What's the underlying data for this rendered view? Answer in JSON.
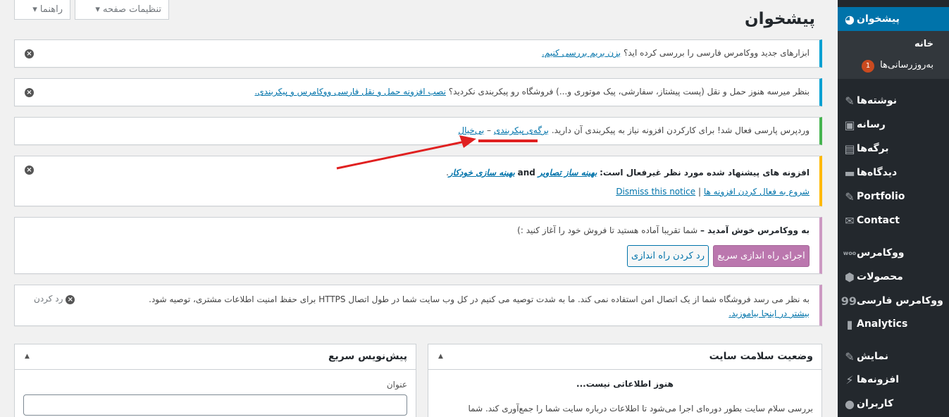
{
  "header": {
    "page_title": "پیشخوان",
    "help_tab": "راهنما ▾",
    "screen_options_tab": "تنظیمات صفحه ▾"
  },
  "sidebar": {
    "dashboard": "پیشخوان",
    "home": "خانه",
    "updates": "به‌روزرسانی‌ها",
    "updates_count": "1",
    "posts": "نوشته‌ها",
    "media": "رسانه",
    "pages": "برگه‌ها",
    "comments": "دیدگاه‌ها",
    "portfolio": "Portfolio",
    "contact": "Contact",
    "woocommerce": "ووکامرس",
    "products": "محصولات",
    "woocommerce_fa": "ووکامرس فارسی",
    "analytics": "Analytics",
    "appearance": "نمایش",
    "plugins": "افزونه‌ها",
    "users": "کاربران"
  },
  "notices": {
    "n1_text": "ابزارهای جدید ووکامرس فارسی را بررسی کرده اید؟",
    "n1_link": "بزن بریم بررسی کنیم.",
    "n2_text": "بنظر میرسه هنوز حمل و نقل (پست پیشتاز، سفارشی، پیک موتوری و...) فروشگاه رو پیکربندی نکردید؟",
    "n2_link": "نصب افزونه حمل و نقل فارسی ووکامرس و پیکربندی.",
    "n3_text": "وردپرس پارسی فعال شد! برای کارکردن افزونه نیاز به پیکربندی آن دارید.",
    "n3_link1": "برگه‌ی پیکربندی",
    "n3_sep": "–",
    "n3_link2": "بی‌خیال",
    "n4_bold": "افزونه های پیشنهاد شده مورد نظر غیرفعال است:",
    "n4_link1": "بهینه ساز تصاویر",
    "n4_and": "and",
    "n4_link2": "بهینه سازی خودکار",
    "n4_dot": ".",
    "n4_activate": "شروع به فعال کردن افزونه ها",
    "n4_pipe": "|",
    "n4_dismiss": "Dismiss this notice",
    "n5_bold": "به ووکامرس خوش آمدید –",
    "n5_text": "شما تقریبا آماده هستید تا فروش خود را آغاز کنید :)",
    "n5_primary": "اجرای راه اندازی سریع",
    "n5_secondary": "رد کردن راه اندازی",
    "n6_text": "به نظر می رسد فروشگاه شما از یک اتصال امن استفاده نمی کند. ما به شدت توصیه می کنیم در کل وب سایت شما در طول اتصال HTTPS برای حفظ امنیت اطلاعات مشتری، توصیه شود.",
    "n6_link": "بیشتر در اینجا بیاموزید.",
    "n6_dismiss": "رد کردن"
  },
  "health_box": {
    "title": "وضعیت سلامت سایت",
    "empty": "هنوز اطلاعاتی نیست...",
    "desc": "بررسی سلام سایت بطور دوره‌ای اجرا می‌شود تا اطلاعات درباره سایت شما را جمع‌آوری کند. شما"
  },
  "quick_draft": {
    "title": "پیش‌نویس سریع",
    "title_label": "عنوان"
  },
  "colors": {
    "sidebar_bg": "#23282d",
    "accent": "#0073aa",
    "info_border": "#00a0d2",
    "success_border": "#46b450",
    "warning_border": "#ffb900",
    "woo_border": "#cc99c2",
    "woo_button": "#bb77ae",
    "arrow_red": "#e02020"
  }
}
